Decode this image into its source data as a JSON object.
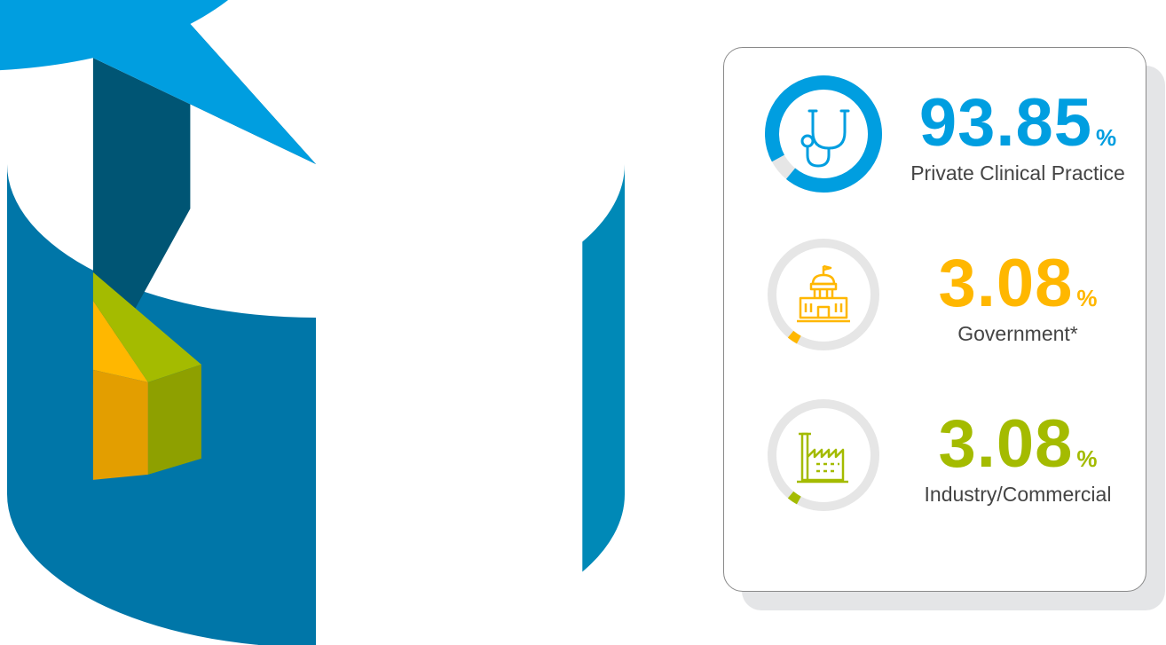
{
  "chart_data": {
    "type": "pie",
    "title": "",
    "categories": [
      "Private Clinical Practice",
      "Government*",
      "Industry/Commercial"
    ],
    "values": [
      93.85,
      3.08,
      3.08
    ],
    "unit": "%",
    "style": "3d-cylinder-pie",
    "colors": {
      "private_top": "#009ee0",
      "private_side_left": "#0076a8",
      "private_side_right": "#0089b7",
      "cut_face": "#005574",
      "government_top": "#ffb700",
      "government_side": "#e39e00",
      "industry_top": "#a4bb00",
      "industry_side": "#8ea000"
    }
  },
  "stats": [
    {
      "value": "93.85",
      "unit": "%",
      "label": "Private Clinical Practice",
      "icon": "stethoscope-icon",
      "color": "#009ee0",
      "fraction": 0.9385
    },
    {
      "value": "3.08",
      "unit": "%",
      "label": "Government*",
      "icon": "government-building-icon",
      "color": "#ffb700",
      "fraction": 0.0308
    },
    {
      "value": "3.08",
      "unit": "%",
      "label": "Industry/Commercial",
      "icon": "factory-icon",
      "color": "#a4bb00",
      "fraction": 0.0308
    }
  ],
  "ring_track_color": "#e6e6e6"
}
